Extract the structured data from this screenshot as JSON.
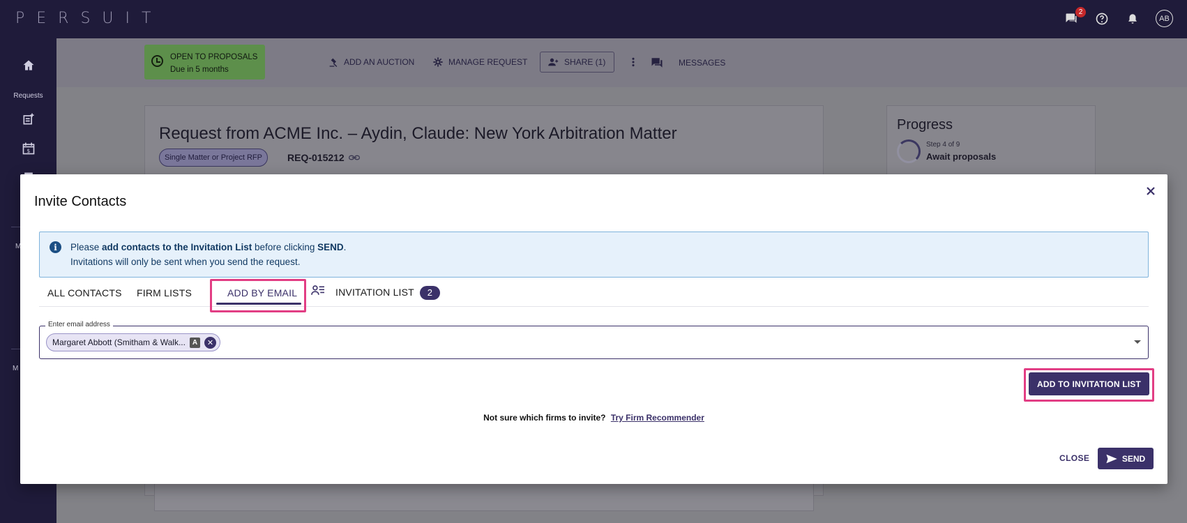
{
  "app": {
    "logo": "PERSUIT"
  },
  "topbar": {
    "messages_badge": "2",
    "avatar_initials": "AB"
  },
  "rail": {
    "requests_label": "Requests",
    "my_label_1": "M",
    "my_label_2": "M"
  },
  "background": {
    "status_title": "OPEN TO PROPOSALS",
    "status_sub": "Due in 5 months",
    "actions": {
      "add_auction": "ADD AN AUCTION",
      "manage_request": "MANAGE REQUEST",
      "share": "SHARE (1)",
      "messages": "MESSAGES"
    },
    "request_title": "Request from ACME Inc. – Aydin, Claude: New York Arbitration Matter",
    "request_type": "Single Matter or Project RFP",
    "request_id": "REQ-015212",
    "progress": {
      "title": "Progress",
      "step": "Step 4 of 9",
      "step_name": "Await proposals"
    }
  },
  "modal": {
    "title": "Invite Contacts",
    "info": {
      "line1_pre": "Please ",
      "line1_bold": "add contacts to the Invitation List",
      "line1_mid": " before clicking ",
      "line1_send": "SEND",
      "line1_end": ".",
      "line2": "Invitations will only be sent when you send the request."
    },
    "tabs": {
      "all_contacts": "ALL CONTACTS",
      "firm_lists": "FIRM LISTS",
      "add_by_email": "ADD BY EMAIL",
      "invitation_list": "INVITATION LIST",
      "invitation_count": "2"
    },
    "email": {
      "legend": "Enter email address",
      "chip_label": "Margaret Abbott (Smitham & Walk...",
      "chip_badge": "A"
    },
    "add_button": "ADD TO INVITATION LIST",
    "recommend_question": "Not sure which firms to invite?",
    "recommend_link": "Try Firm Recommender",
    "close_button": "CLOSE",
    "send_button": "SEND"
  },
  "colors": {
    "brand": "#3b3169",
    "highlight": "#e23e84",
    "info_bg": "#e6f1fb"
  }
}
